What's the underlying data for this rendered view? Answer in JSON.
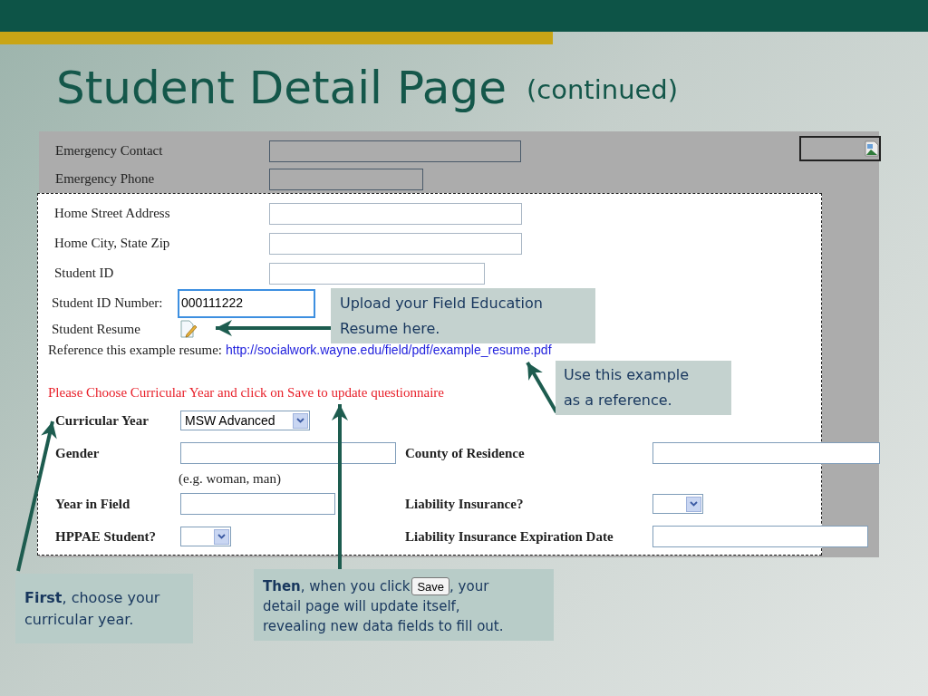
{
  "slide": {
    "title": "Student Detail Page",
    "title_suffix": "(continued)"
  },
  "form": {
    "emergency_fields": [
      {
        "label": "Emergency Contact"
      },
      {
        "label": "Emergency Phone"
      }
    ],
    "address_fields": [
      {
        "label": "Home Street Address"
      },
      {
        "label": "Home City, State Zip"
      },
      {
        "label": "Student ID"
      }
    ],
    "student_id_number": {
      "label": "Student ID Number:",
      "value": "000111222",
      "focused": true
    },
    "resume": {
      "label": "Student Resume"
    },
    "reference": {
      "text": "Reference this example resume:",
      "link": "http://socialwork.wayne.edu/field/pdf/example_resume.pdf"
    },
    "notice": "Please Choose Curricular Year and click on Save to update questionnaire",
    "curricular_year": {
      "label": "Curricular Year",
      "value": "MSW Advanced"
    },
    "left_fields": [
      {
        "label": "Gender",
        "kind": "text",
        "hint": "(e.g. woman, man)"
      },
      {
        "label": "Year in Field",
        "kind": "text"
      },
      {
        "label": "HPPAE Student?",
        "kind": "select"
      }
    ],
    "right_fields": [
      {
        "label": "County of Residence",
        "kind": "text"
      },
      {
        "label": "Liability Insurance?",
        "kind": "select"
      },
      {
        "label": "Liability Insurance Expiration Date",
        "kind": "text"
      }
    ]
  },
  "callouts": [
    {
      "text": "Upload your Field Education Resume here."
    },
    {
      "text": "Use this example as a reference."
    },
    {
      "text": "**First**, choose your curricular year."
    },
    {
      "text_before": "**Then**, when you click",
      "button": "Save",
      "text_after": ", your",
      "more_lines": [
        "detail page will update itself,",
        "revealing new data fields to fill out."
      ]
    }
  ]
}
